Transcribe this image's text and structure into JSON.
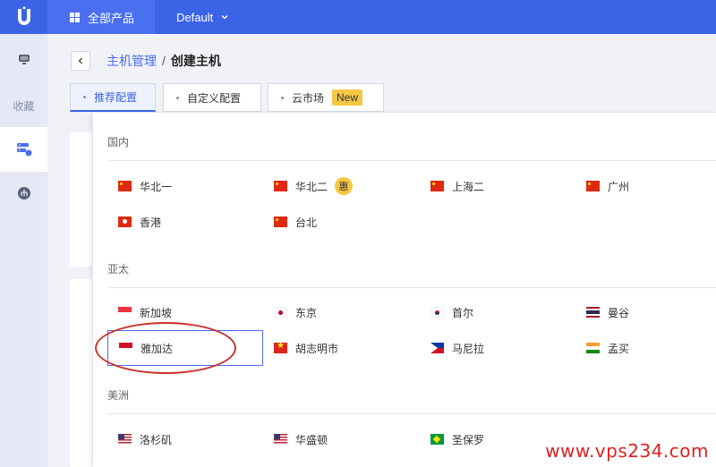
{
  "topbar": {
    "products_label": "全部产品",
    "project_label": "Default"
  },
  "sidebar": {
    "favorites_label": "收藏"
  },
  "breadcrumb": {
    "parent": "主机管理",
    "separator": "/",
    "current": "创建主机"
  },
  "tabs": [
    {
      "label": "推荐配置"
    },
    {
      "label": "自定义配置"
    },
    {
      "label": "云市场",
      "badge": "New"
    }
  ],
  "sections": {
    "domestic": "国内",
    "apac": "亚太",
    "americas": "美洲"
  },
  "regions": {
    "domestic": [
      {
        "label": "华北一",
        "flag": "cn"
      },
      {
        "label": "华北二",
        "flag": "cn",
        "badge": "惠"
      },
      {
        "label": "上海二",
        "flag": "cn"
      },
      {
        "label": "广州",
        "flag": "cn"
      },
      {
        "label": "香港",
        "flag": "hk"
      },
      {
        "label": "台北",
        "flag": "cn"
      }
    ],
    "apac": [
      {
        "label": "新加坡",
        "flag": "sg"
      },
      {
        "label": "东京",
        "flag": "jp"
      },
      {
        "label": "首尔",
        "flag": "kr"
      },
      {
        "label": "曼谷",
        "flag": "th"
      },
      {
        "label": "雅加达",
        "flag": "id",
        "selected": true
      },
      {
        "label": "胡志明市",
        "flag": "vn"
      },
      {
        "label": "马尼拉",
        "flag": "ph"
      },
      {
        "label": "孟买",
        "flag": "in"
      }
    ],
    "americas": [
      {
        "label": "洛杉矶",
        "flag": "us"
      },
      {
        "label": "华盛顿",
        "flag": "us"
      },
      {
        "label": "圣保罗",
        "flag": "br"
      }
    ]
  },
  "watermark": "www.vps234.com",
  "colors": {
    "brand": "#3b63e6",
    "badge": "#f6c744",
    "annotation": "#c9302c",
    "watermark": "#e02020"
  }
}
